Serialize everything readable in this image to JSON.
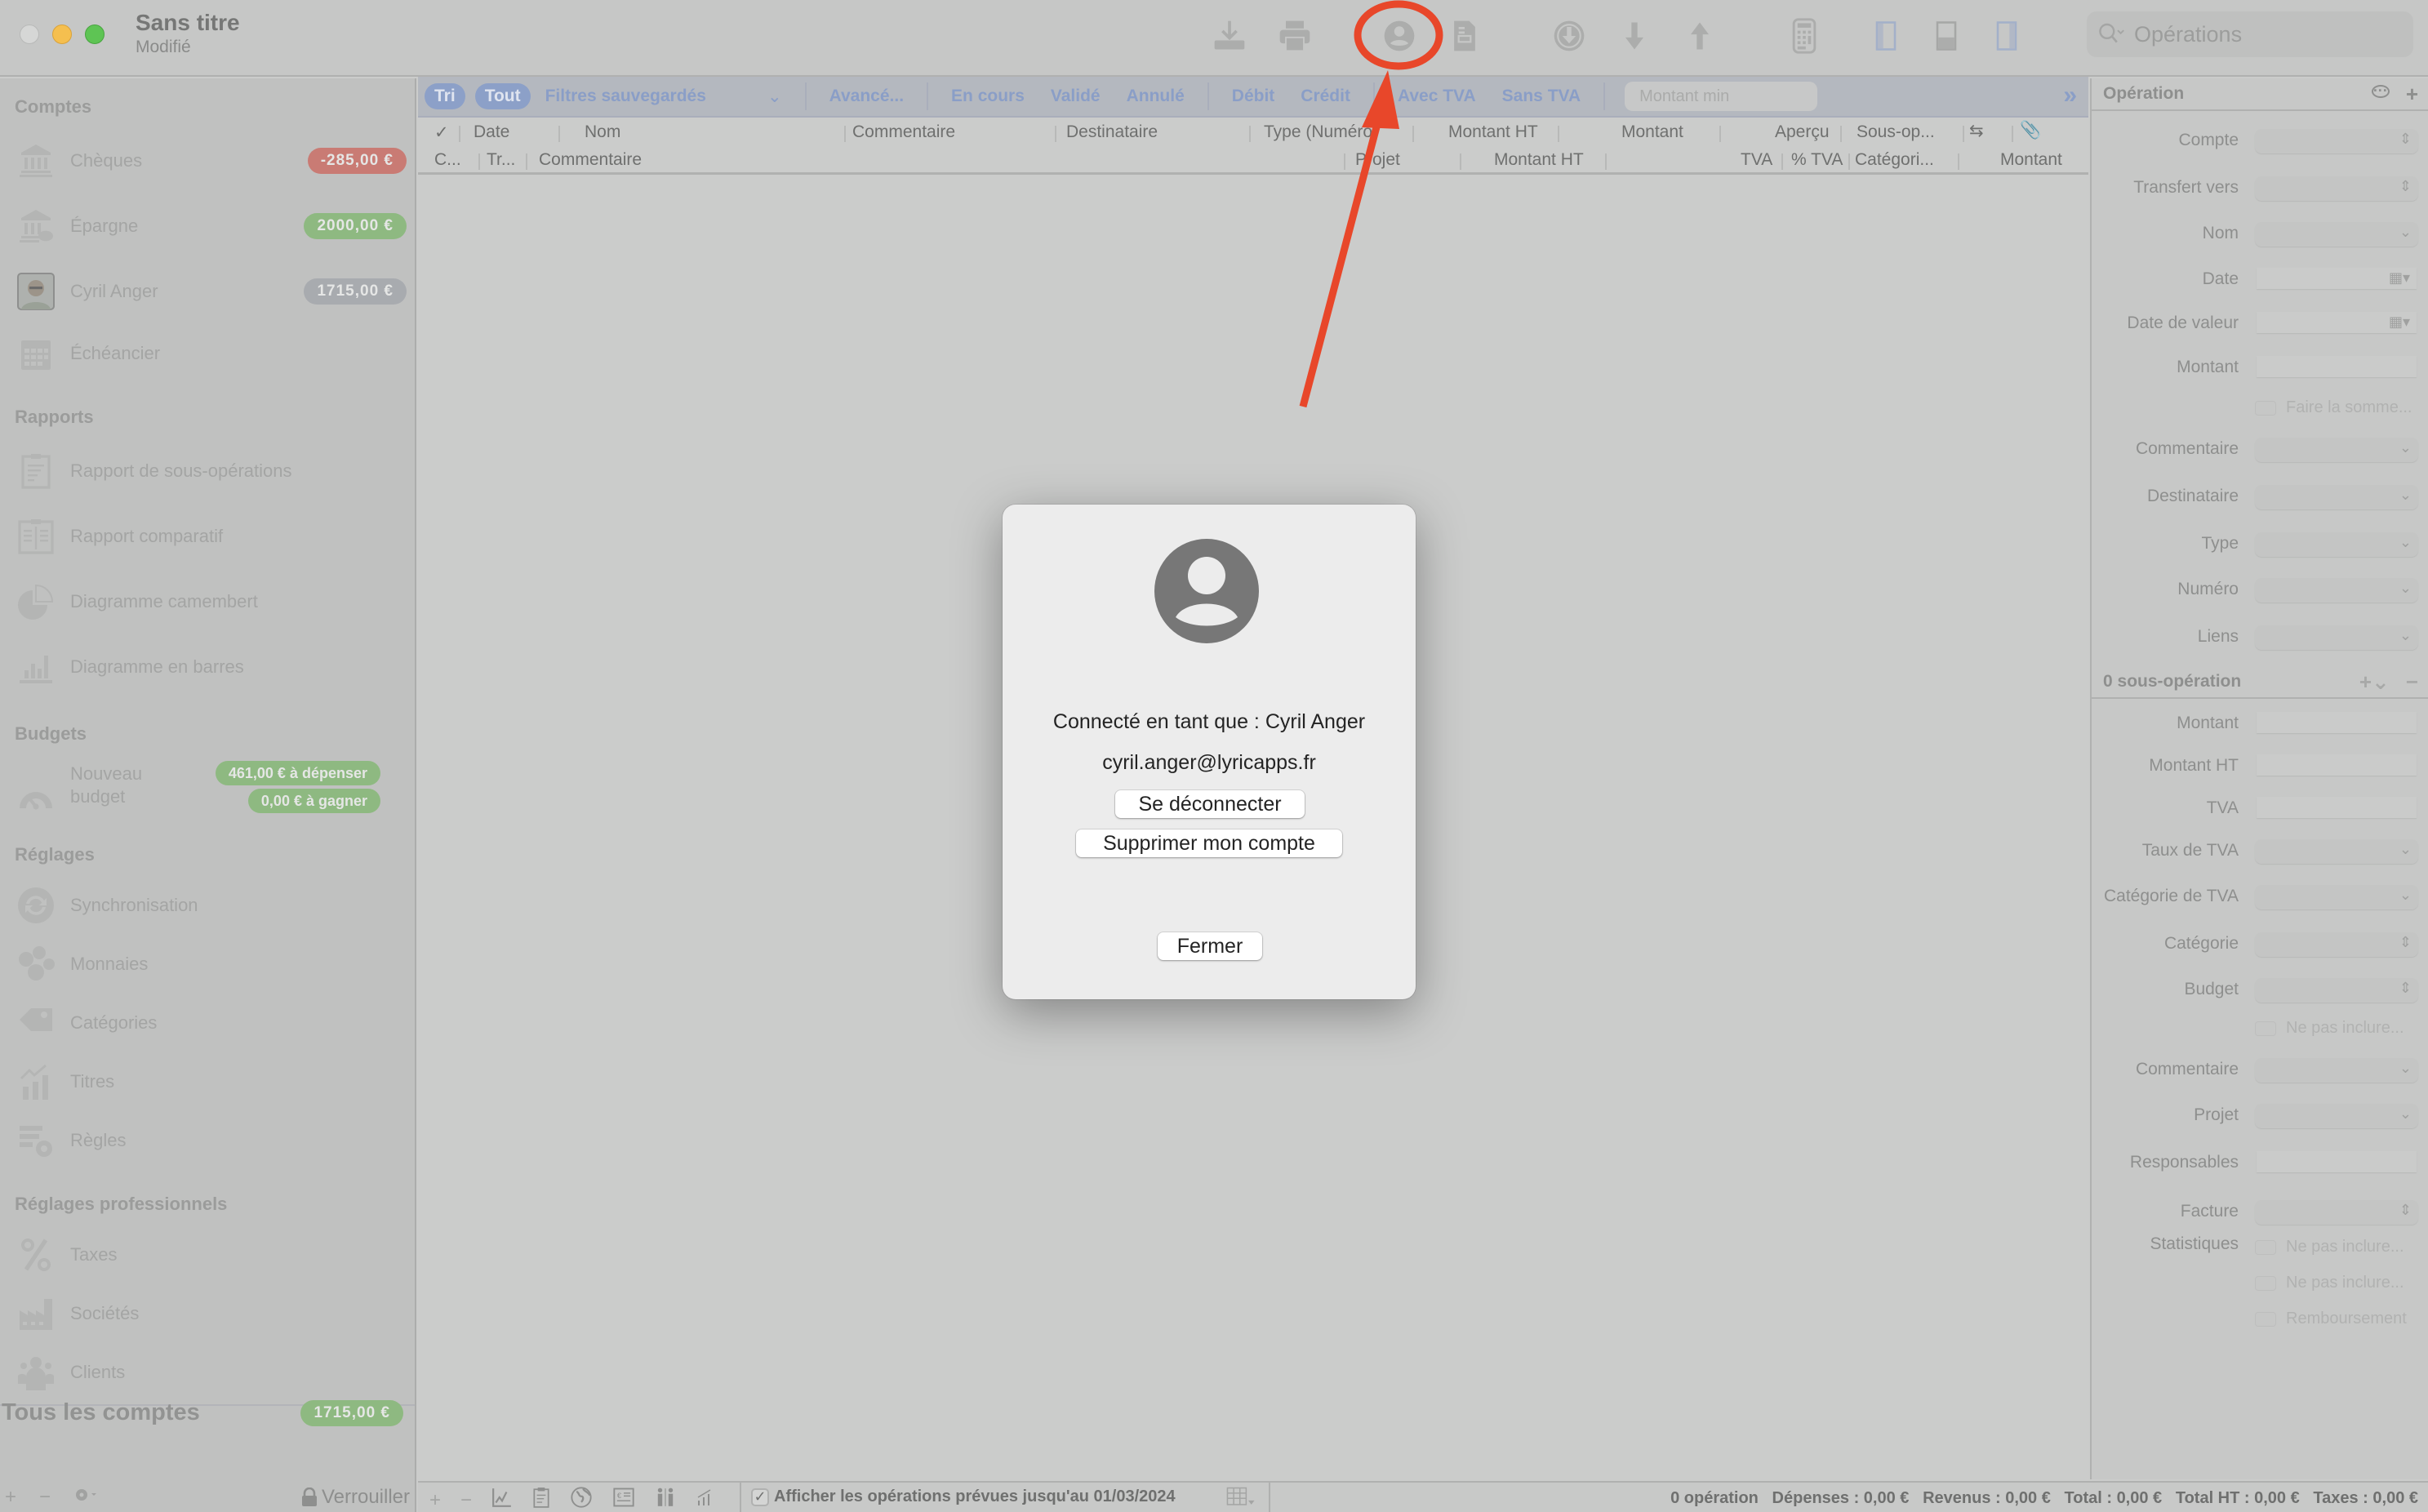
{
  "window": {
    "title": "Sans titre",
    "subtitle": "Modifié"
  },
  "toolbar": {
    "icons": [
      "import-icon",
      "print-icon",
      "account-icon",
      "report-document-icon",
      "download-circle-icon",
      "download-arrow-icon",
      "upload-arrow-icon",
      "calculator-icon",
      "left-panel-toggle-icon",
      "bottom-panel-toggle-icon",
      "right-panel-toggle-icon"
    ],
    "search_placeholder": "Opérations"
  },
  "sidebar": {
    "sections": {
      "accounts": "Comptes",
      "reports": "Rapports",
      "budgets": "Budgets",
      "settings": "Réglages",
      "pro_settings": "Réglages professionnels"
    },
    "accounts": [
      {
        "label": "Chèques",
        "balance": "-285,00 €",
        "status": "negative"
      },
      {
        "label": "Épargne",
        "balance": "2000,00 €",
        "status": "positive"
      },
      {
        "label": "Cyril Anger",
        "balance": "1715,00 €",
        "status": "neutral"
      },
      {
        "label": "Échéancier"
      }
    ],
    "reports": [
      {
        "label": "Rapport de sous-opérations"
      },
      {
        "label": "Rapport comparatif"
      },
      {
        "label": "Diagramme camembert"
      },
      {
        "label": "Diagramme en barres"
      }
    ],
    "budget": {
      "label_line1": "Nouveau",
      "label_line2": "budget",
      "to_spend": "461,00 € à dépenser",
      "to_earn": "0,00 € à gagner"
    },
    "settings": [
      {
        "label": "Synchronisation"
      },
      {
        "label": "Monnaies"
      },
      {
        "label": "Catégories"
      },
      {
        "label": "Titres"
      },
      {
        "label": "Règles"
      }
    ],
    "pro_settings": [
      {
        "label": "Taxes"
      },
      {
        "label": "Sociétés"
      },
      {
        "label": "Clients"
      }
    ],
    "total": {
      "label": "Tous les comptes",
      "balance": "1715,00 €"
    },
    "footer": {
      "add": "+",
      "remove": "−",
      "lock": "Verrouiller"
    }
  },
  "filters": {
    "sort": "Tri",
    "all": "Tout",
    "saved": "Filtres sauvegardés",
    "advanced": "Avancé...",
    "pending": "En cours",
    "validated": "Validé",
    "cancelled": "Annulé",
    "debit": "Débit",
    "credit": "Crédit",
    "with_vat": "Avec TVA",
    "without_vat": "Sans TVA",
    "min_amount_placeholder": "Montant min"
  },
  "columns": {
    "row1": [
      "✓",
      "Date",
      "Nom",
      "Commentaire",
      "Destinataire",
      "Type (Numéro)",
      "Montant HT",
      "Montant",
      "Aperçu",
      "Sous-op..."
    ],
    "row2": [
      "C...",
      "Tr...",
      "Commentaire",
      "Projet",
      "Montant HT",
      "TVA",
      "% TVA",
      "Catégori...",
      "Montant"
    ]
  },
  "status": {
    "show_planned": "Afficher les opérations prévues jusqu'au 01/03/2024",
    "show_planned_checked": true,
    "summary": "0 opération   Dépenses : 0,00 €   Revenus : 0,00 €   Total : 0,00 €   Total HT : 0,00 €   Taxes : 0,00 €"
  },
  "inspector": {
    "operation_title": "Opération",
    "fields": [
      "Compte",
      "Transfert vers",
      "Nom",
      "Date",
      "Date de valeur",
      "Montant"
    ],
    "sum_checkbox": "Faire la somme...",
    "fields2": [
      "Commentaire",
      "Destinataire",
      "Type",
      "Numéro",
      "Liens"
    ],
    "sub_title": "0 sous-opération",
    "sub_fields": [
      "Montant",
      "Montant HT",
      "TVA",
      "Taux de TVA",
      "Catégorie de TVA",
      "Catégorie",
      "Budget"
    ],
    "budget_exclude": "Ne pas inclure...",
    "sub_fields2": [
      "Commentaire",
      "Projet",
      "Responsables",
      "Facture"
    ],
    "stats_label": "Statistiques",
    "stats_checks": [
      "Ne pas inclure...",
      "Ne pas inclure...",
      "Remboursement"
    ]
  },
  "modal": {
    "logged_in_as": "Connecté en tant que : Cyril Anger",
    "email": "cyril.anger@lyricapps.fr",
    "logout": "Se déconnecter",
    "delete_account": "Supprimer mon compte",
    "close": "Fermer"
  },
  "colors": {
    "annotation": "#e8472a",
    "filter_accent": "#8a9ec7",
    "badge_red": "#c97b74",
    "badge_green": "#8eb981"
  }
}
